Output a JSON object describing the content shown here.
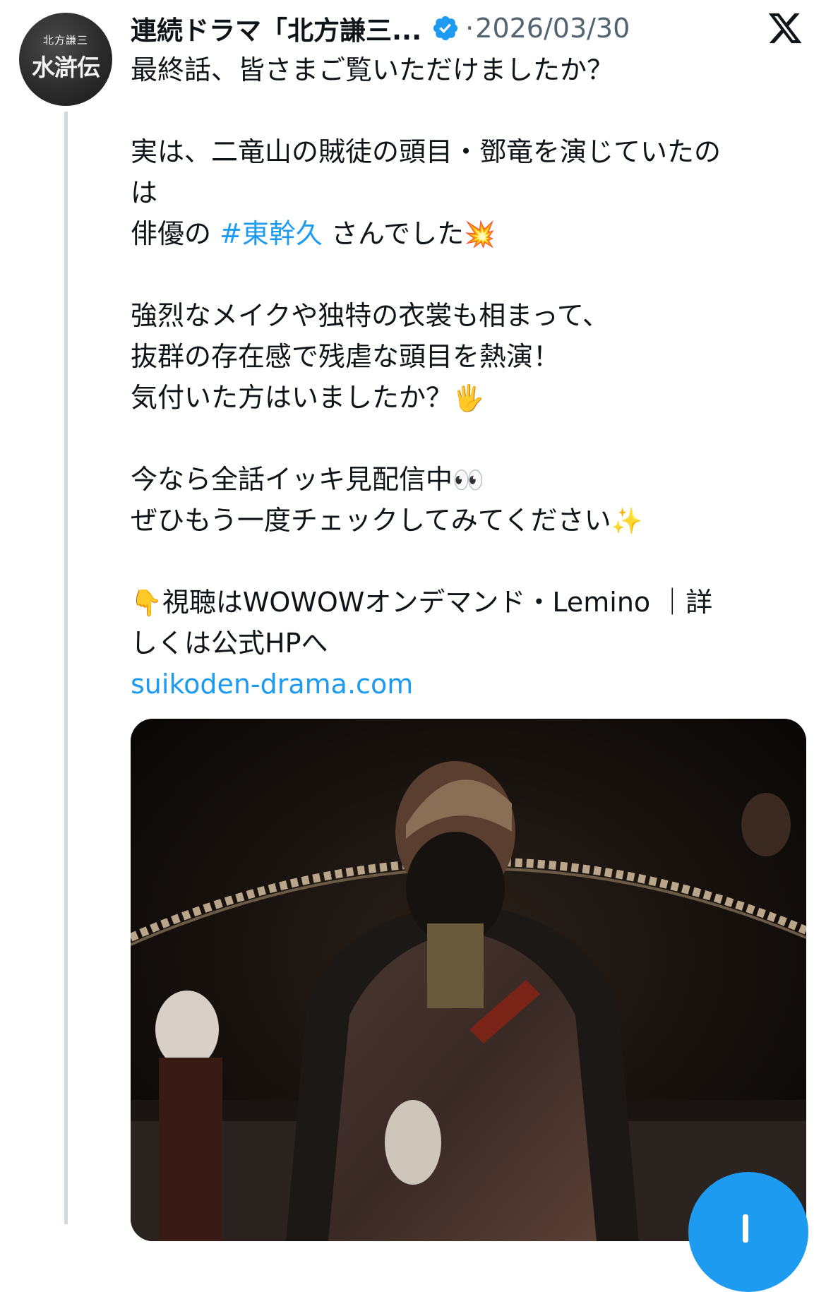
{
  "tweet": {
    "avatar": {
      "small_text": "北方謙三",
      "big_text": "水滸伝"
    },
    "display_name": "連続ドラマ「北方謙三...",
    "separator": "·",
    "date": "2026/03/30",
    "lines": [
      {
        "text": "最終話、皆さまご覧いただけましたか？"
      },
      {
        "blank": true
      },
      {
        "text": "実は、二竜山の賊徒の頭目・鄧竜を演じていたの"
      },
      {
        "text": "は"
      },
      {
        "pre": "俳優の ",
        "hashtag": "#東幹久",
        "post": " さんでした",
        "emoji": "💥"
      },
      {
        "blank": true
      },
      {
        "text": "強烈なメイクや独特の衣裳も相まって、"
      },
      {
        "text": "抜群の存在感で残虐な頭目を熱演！"
      },
      {
        "text": "気付いた方はいましたか？",
        "emoji": "🖐"
      },
      {
        "blank": true
      },
      {
        "text": "今なら全話イッキ見配信中",
        "emoji": "👀"
      },
      {
        "text": "ぜひもう一度チェックしてみてください",
        "emoji": "✨"
      },
      {
        "blank": true
      },
      {
        "emoji_pre": "👇",
        "text": "視聴はWOWOWオンデマンド・Lemino ｜詳"
      },
      {
        "text": "しくは公式HPへ"
      },
      {
        "link": "suikoden-drama.com"
      }
    ]
  },
  "media": {
    "icon": "photo-icon"
  },
  "colors": {
    "link": "#1d9bf0",
    "verified": "#1d9bf0",
    "secondary_text": "#536471",
    "thread_line": "#cfd9de",
    "fab": "#1d9bf0"
  },
  "icons": {
    "verified": "verified-badge-icon",
    "brand": "x-logo-icon",
    "compose": "plus-icon"
  }
}
